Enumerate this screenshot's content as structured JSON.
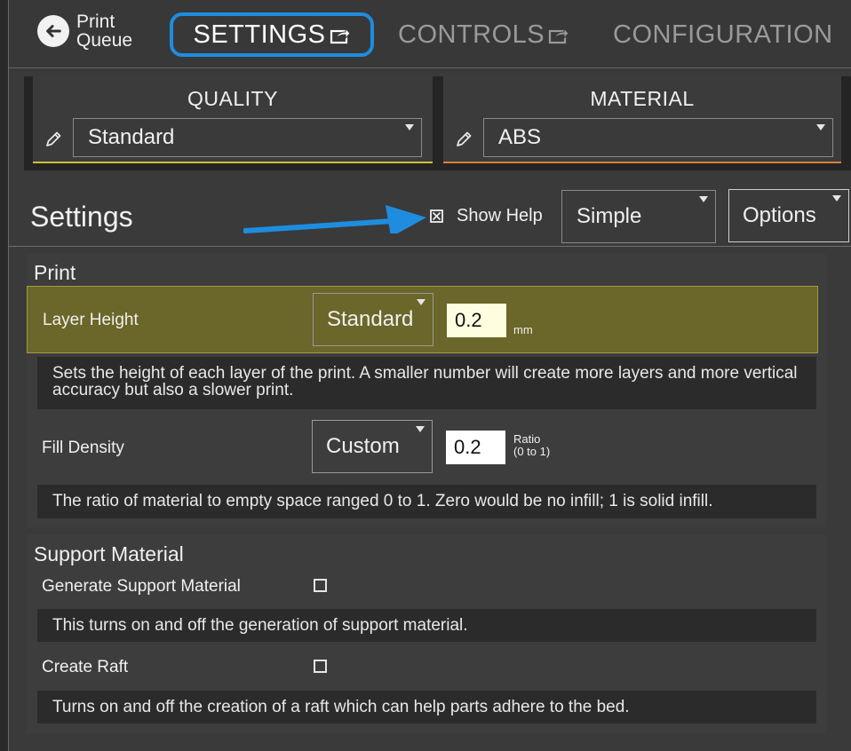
{
  "nav": {
    "back_label_line1": "Print",
    "back_label_line2": "Queue",
    "tabs": [
      {
        "label": "SETTINGS"
      },
      {
        "label": "CONTROLS"
      },
      {
        "label": "CONFIGURATION"
      }
    ]
  },
  "quality": {
    "title": "QUALITY",
    "selected": "Standard",
    "accent": "#c9c23a"
  },
  "material": {
    "title": "MATERIAL",
    "selected": "ABS",
    "accent": "#d6823a"
  },
  "settings_header": {
    "title": "Settings",
    "show_help_label": "Show Help",
    "show_help_checked": true,
    "mode_selected": "Simple",
    "options_label": "Options",
    "annotation_color": "#1e8de0"
  },
  "print_section": {
    "title": "Print",
    "layer_height": {
      "label": "Layer Height",
      "preset": "Standard",
      "value": "0.2",
      "unit": "mm",
      "help": "Sets the height of each layer of the print. A smaller number will create more layers and more vertical accuracy but also a slower print."
    },
    "fill_density": {
      "label": "Fill Density",
      "preset": "Custom",
      "value": "0.2",
      "unit_line1": "Ratio",
      "unit_line2": "(0 to 1)",
      "help": "The ratio of material to empty space ranged 0 to 1. Zero would be no infill; 1 is solid infill."
    }
  },
  "support_section": {
    "title": "Support Material",
    "generate_support": {
      "label": "Generate Support Material",
      "checked": false,
      "help": "This turns on and off the generation of support material."
    },
    "create_raft": {
      "label": "Create Raft",
      "checked": false,
      "help": "Turns on and off the creation of a raft which can help parts adhere to the bed."
    }
  }
}
